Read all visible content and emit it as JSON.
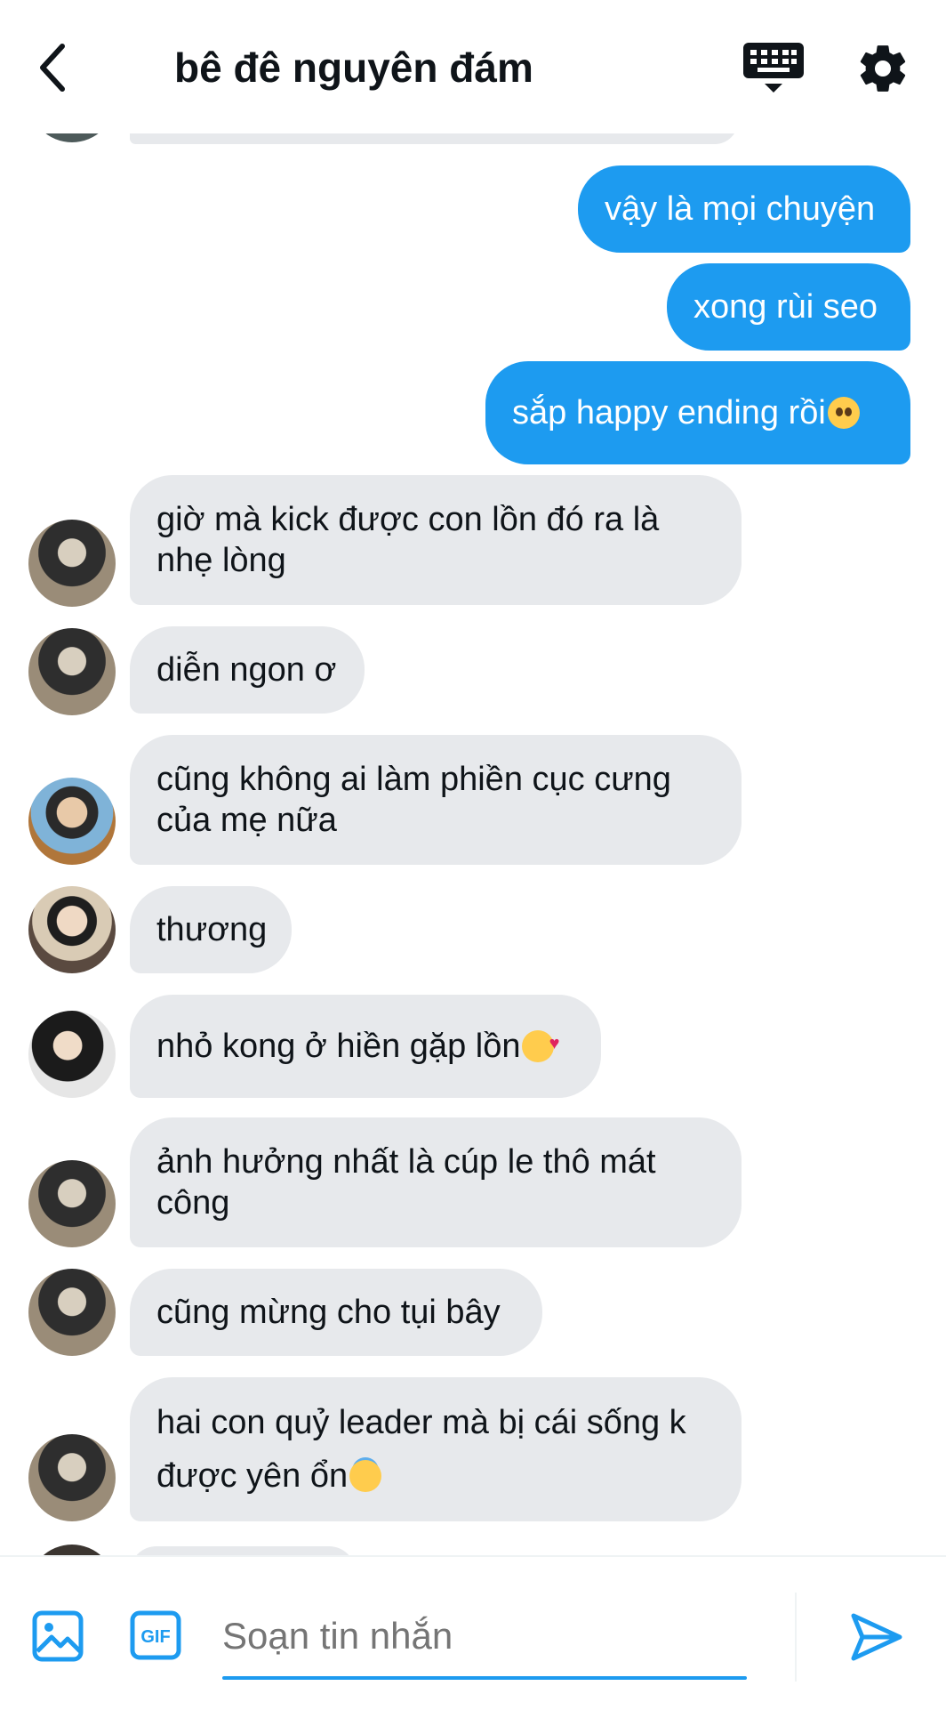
{
  "header": {
    "title": "bê đê nguyên đám",
    "icons": [
      "back-arrow-icon",
      "keyboard-icon",
      "gear-icon"
    ]
  },
  "colors": {
    "accent": "#1d9bf0",
    "incoming_bubble": "#e7e9ec",
    "text": "#0f1419"
  },
  "messages": {
    "outgoing": [
      {
        "text": "vậy là mọi chuyện"
      },
      {
        "text": "xong rùi seo"
      },
      {
        "text": "sắp happy ending rồi",
        "emoji": "pleading-face-emoji"
      }
    ],
    "incoming": [
      {
        "line1": "giờ mà kick được con lồn đó ra là",
        "line2": "nhẹ lòng"
      },
      {
        "text": "diễn ngon ơ"
      },
      {
        "line1": "cũng không ai làm phiền cục cưng",
        "line2": "của mẹ nữa"
      },
      {
        "text": "thương"
      },
      {
        "text": "nhỏ kong ở hiền gặp lồn",
        "emoji": "smiling-face-with-hearts-emoji"
      },
      {
        "line1": "ảnh hưởng nhất là cúp le thô mát",
        "line2": "công"
      },
      {
        "text": "cũng mừng cho tụi bây"
      },
      {
        "line1": "hai con quỷ leader mà bị cái sống k",
        "line2": "được yên ổn",
        "emoji": "smiling-face-with-halo-emoji"
      }
    ]
  },
  "composer": {
    "placeholder": "Soạn tin nhắn",
    "icons": [
      "image-icon",
      "gif-icon",
      "send-icon"
    ],
    "gif_label": "GIF"
  }
}
